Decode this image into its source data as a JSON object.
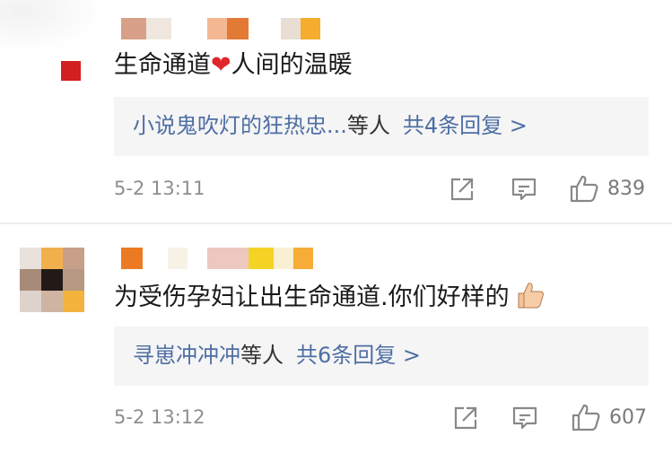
{
  "comments": [
    {
      "text": "生命通道",
      "emoji": "❤️",
      "text_after": "人间的温暖",
      "reply_names": "小说鬼吹灯的狂热忠...",
      "reply_suffix": "等人",
      "reply_count": "共4条回复 >",
      "time": "5-2 13:11",
      "likes": "839"
    },
    {
      "text": "为受伤孕妇让出生命通道.你们好样的",
      "emoji": "👍",
      "reply_names": "寻崽冲冲冲",
      "reply_suffix": "等人",
      "reply_count": "共6条回复 >",
      "time": "5-2 13:12",
      "likes": "607"
    }
  ],
  "icons": {
    "repost": "share-icon",
    "comment": "comment-icon",
    "like": "thumbs-up-icon"
  },
  "colors": {
    "link": "#4e6ea4",
    "reply_bg": "#f5f5f5",
    "meta": "#8e8e8e"
  }
}
